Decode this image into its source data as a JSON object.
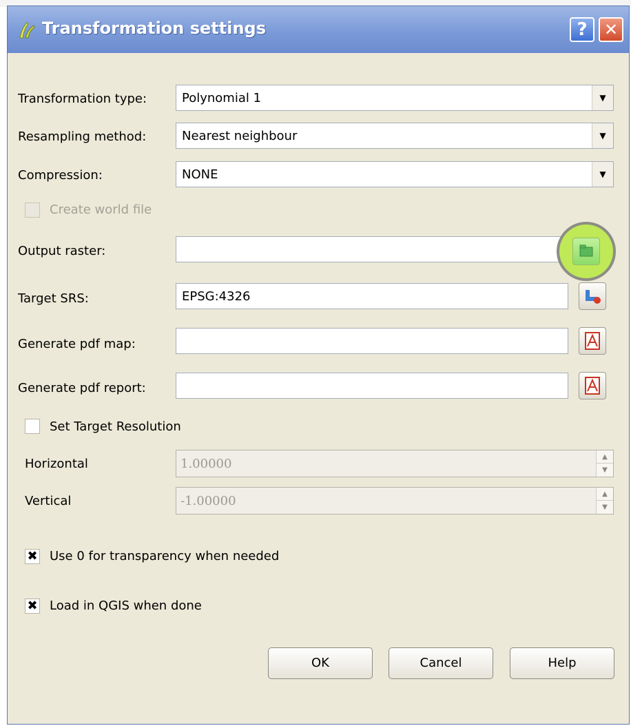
{
  "dialog": {
    "title": "Transformation settings",
    "title_buttons": {
      "help": "?",
      "close": "✕"
    },
    "icon": "qgis-icon"
  },
  "form": {
    "transformation_type": {
      "label": "Transformation type:",
      "value": "Polynomial 1"
    },
    "resampling_method": {
      "label": "Resampling method:",
      "value": "Nearest neighbour"
    },
    "compression": {
      "label": "Compression:",
      "value": "NONE"
    },
    "create_world_file": {
      "label": "Create world file",
      "checked": false,
      "enabled": false
    },
    "output_raster": {
      "label": "Output raster:",
      "value": "",
      "button_icon": "folder-open-icon"
    },
    "target_srs": {
      "label": "Target SRS:",
      "value": "EPSG:4326",
      "button_icon": "projection-selector-icon"
    },
    "generate_pdf_map": {
      "label": "Generate pdf map:",
      "value": "",
      "button_icon": "pdf-icon"
    },
    "generate_pdf_report": {
      "label": "Generate pdf report:",
      "value": "",
      "button_icon": "pdf-icon"
    },
    "set_target_resolution": {
      "label": "Set Target Resolution",
      "checked": false
    },
    "horizontal": {
      "label": "Horizontal",
      "value": "1.00000"
    },
    "vertical": {
      "label": "Vertical",
      "value": "-1.00000"
    },
    "use_zero_transparency": {
      "label": "Use 0 for transparency when needed",
      "checked": true,
      "mark": "✖"
    },
    "load_in_qgis": {
      "label": "Load in QGIS when done",
      "checked": true,
      "mark": "✖"
    }
  },
  "buttons": {
    "ok": "OK",
    "cancel": "Cancel",
    "help": "Help"
  },
  "colors": {
    "highlight": "#bfe957",
    "titlebar": "#7b9ad8",
    "dialog_bg": "#ece9d8"
  }
}
